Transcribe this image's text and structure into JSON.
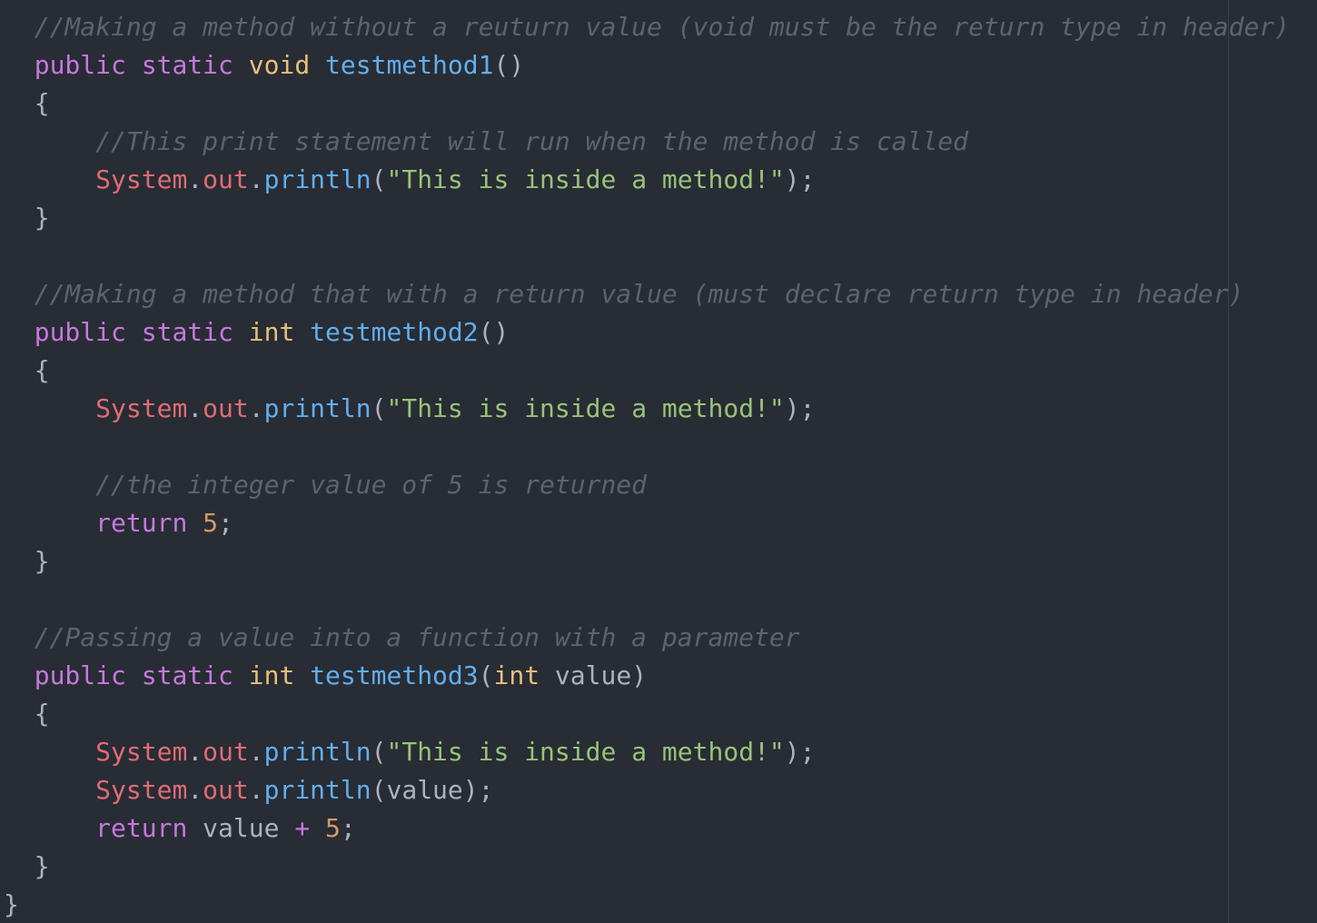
{
  "editor": {
    "theme": {
      "background": "#282c34",
      "comment": "#5c6370",
      "keyword": "#c678dd",
      "type": "#e5c07b",
      "function": "#61afef",
      "class": "#e06c75",
      "string": "#98c379",
      "number": "#d19a66",
      "plain": "#abb2bf"
    },
    "lines": [
      [
        {
          "t": "comment",
          "v": "  //Making a method without a reuturn value (void must be the return type in header)"
        }
      ],
      [
        {
          "t": "plain",
          "v": "  "
        },
        {
          "t": "keyword",
          "v": "public"
        },
        {
          "t": "plain",
          "v": " "
        },
        {
          "t": "keyword",
          "v": "static"
        },
        {
          "t": "plain",
          "v": " "
        },
        {
          "t": "type",
          "v": "void"
        },
        {
          "t": "plain",
          "v": " "
        },
        {
          "t": "function",
          "v": "testmethod1"
        },
        {
          "t": "punct",
          "v": "()"
        }
      ],
      [
        {
          "t": "punct",
          "v": "  {"
        }
      ],
      [
        {
          "t": "comment",
          "v": "      //This print statement will run when the method is called"
        }
      ],
      [
        {
          "t": "plain",
          "v": "      "
        },
        {
          "t": "class",
          "v": "System"
        },
        {
          "t": "punct",
          "v": "."
        },
        {
          "t": "property",
          "v": "out"
        },
        {
          "t": "punct",
          "v": "."
        },
        {
          "t": "function",
          "v": "println"
        },
        {
          "t": "punct",
          "v": "("
        },
        {
          "t": "string",
          "v": "\"This is inside a method!\""
        },
        {
          "t": "punct",
          "v": ");"
        }
      ],
      [
        {
          "t": "punct",
          "v": "  }"
        }
      ],
      [],
      [
        {
          "t": "comment",
          "v": "  //Making a method that with a return value (must declare return type in header)"
        }
      ],
      [
        {
          "t": "plain",
          "v": "  "
        },
        {
          "t": "keyword",
          "v": "public"
        },
        {
          "t": "plain",
          "v": " "
        },
        {
          "t": "keyword",
          "v": "static"
        },
        {
          "t": "plain",
          "v": " "
        },
        {
          "t": "type",
          "v": "int"
        },
        {
          "t": "plain",
          "v": " "
        },
        {
          "t": "function",
          "v": "testmethod2"
        },
        {
          "t": "punct",
          "v": "()"
        }
      ],
      [
        {
          "t": "punct",
          "v": "  {"
        }
      ],
      [
        {
          "t": "plain",
          "v": "      "
        },
        {
          "t": "class",
          "v": "System"
        },
        {
          "t": "punct",
          "v": "."
        },
        {
          "t": "property",
          "v": "out"
        },
        {
          "t": "punct",
          "v": "."
        },
        {
          "t": "function",
          "v": "println"
        },
        {
          "t": "punct",
          "v": "("
        },
        {
          "t": "string",
          "v": "\"This is inside a method!\""
        },
        {
          "t": "punct",
          "v": ");"
        }
      ],
      [],
      [
        {
          "t": "comment",
          "v": "      //the integer value of 5 is returned"
        }
      ],
      [
        {
          "t": "plain",
          "v": "      "
        },
        {
          "t": "keyword",
          "v": "return"
        },
        {
          "t": "plain",
          "v": " "
        },
        {
          "t": "number",
          "v": "5"
        },
        {
          "t": "punct",
          "v": ";"
        }
      ],
      [
        {
          "t": "punct",
          "v": "  }"
        }
      ],
      [],
      [
        {
          "t": "comment",
          "v": "  //Passing a value into a function with a parameter"
        }
      ],
      [
        {
          "t": "plain",
          "v": "  "
        },
        {
          "t": "keyword",
          "v": "public"
        },
        {
          "t": "plain",
          "v": " "
        },
        {
          "t": "keyword",
          "v": "static"
        },
        {
          "t": "plain",
          "v": " "
        },
        {
          "t": "type",
          "v": "int"
        },
        {
          "t": "plain",
          "v": " "
        },
        {
          "t": "function",
          "v": "testmethod3"
        },
        {
          "t": "punct",
          "v": "("
        },
        {
          "t": "type",
          "v": "int"
        },
        {
          "t": "plain",
          "v": " value"
        },
        {
          "t": "punct",
          "v": ")"
        }
      ],
      [
        {
          "t": "punct",
          "v": "  {"
        }
      ],
      [
        {
          "t": "plain",
          "v": "      "
        },
        {
          "t": "class",
          "v": "System"
        },
        {
          "t": "punct",
          "v": "."
        },
        {
          "t": "property",
          "v": "out"
        },
        {
          "t": "punct",
          "v": "."
        },
        {
          "t": "function",
          "v": "println"
        },
        {
          "t": "punct",
          "v": "("
        },
        {
          "t": "string",
          "v": "\"This is inside a method!\""
        },
        {
          "t": "punct",
          "v": ");"
        }
      ],
      [
        {
          "t": "plain",
          "v": "      "
        },
        {
          "t": "class",
          "v": "System"
        },
        {
          "t": "punct",
          "v": "."
        },
        {
          "t": "property",
          "v": "out"
        },
        {
          "t": "punct",
          "v": "."
        },
        {
          "t": "function",
          "v": "println"
        },
        {
          "t": "punct",
          "v": "(value);"
        }
      ],
      [
        {
          "t": "plain",
          "v": "      "
        },
        {
          "t": "keyword",
          "v": "return"
        },
        {
          "t": "plain",
          "v": " value "
        },
        {
          "t": "operator",
          "v": "+"
        },
        {
          "t": "plain",
          "v": " "
        },
        {
          "t": "number",
          "v": "5"
        },
        {
          "t": "punct",
          "v": ";"
        }
      ],
      [
        {
          "t": "punct",
          "v": "  }"
        }
      ],
      [
        {
          "t": "punct",
          "v": "}"
        }
      ]
    ]
  }
}
